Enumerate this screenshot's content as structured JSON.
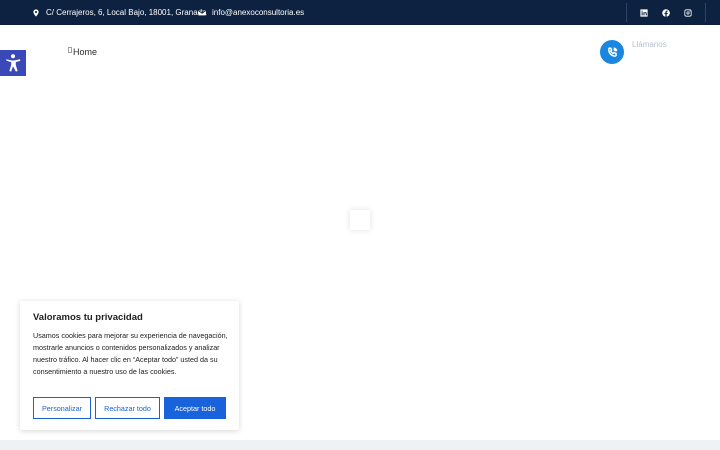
{
  "topbar": {
    "address": "C/ Cerrajeros, 6, Local Bajo, 18001, Granada",
    "email": "info@anexoconsultoria.es",
    "icons": [
      "map-marker-icon",
      "envelope-icon",
      "linkedin-icon",
      "facebook-icon",
      "instagram-icon"
    ],
    "background": "#0d2240"
  },
  "header": {
    "logo_alt": "Home",
    "phone_label": "Llámanos"
  },
  "cookie_banner": {
    "title": "Valoramos tu privacidad",
    "text": "Usamos cookies para mejorar su experiencia de navegación, mostrarle anuncios o contenidos personalizados y analizar nuestro tráfico. Al hacer clic en “Aceptar todo” usted da su consentimiento a nuestro uso de las cookies.",
    "customize_label": "Personalizar",
    "reject_label": "Rechazar todo",
    "accept_label": "Aceptar todo",
    "accent": "#1863dc"
  },
  "accessibility": {
    "icon": "accessibility-icon",
    "color": "#3a48b8"
  }
}
